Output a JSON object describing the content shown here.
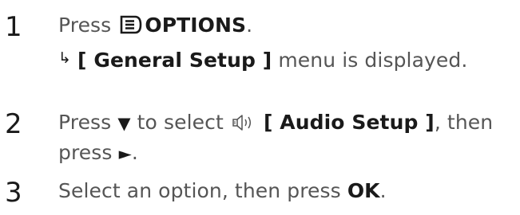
{
  "steps": [
    {
      "number": "1",
      "press_word": "Press",
      "options_label": "OPTIONS",
      "period": ".",
      "result_arrow": "↳",
      "menu_name": "[ General Setup ]",
      "result_text": "menu is displayed."
    },
    {
      "number": "2",
      "press_word": "Press",
      "down_arrow": "▼",
      "to_select": "to select",
      "menu_name": "[ Audio Setup ]",
      "then_text": ", then",
      "press_word_2": "press",
      "right_arrow": "►",
      "period": "."
    },
    {
      "number": "3",
      "select_text": "Select an option, then press",
      "ok_label": "OK",
      "period": "."
    }
  ],
  "icons": {
    "options": "options-icon",
    "audio": "audio-speaker-icon"
  },
  "colors": {
    "body_text": "#555555",
    "emphasis": "#1a1a1a"
  }
}
